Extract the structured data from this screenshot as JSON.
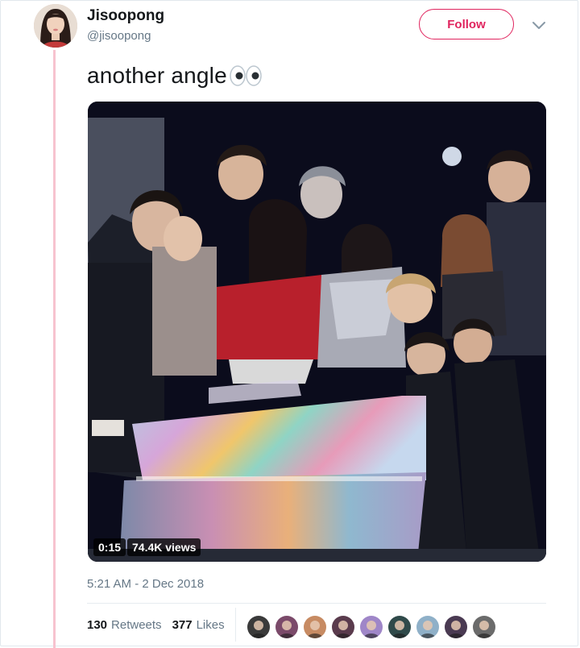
{
  "user": {
    "display_name": "Jisoopong",
    "handle": "@jisoopong",
    "avatar_icon": "profile-photo"
  },
  "follow_label": "Follow",
  "menu_icon": "chevron-down-icon",
  "tweet": {
    "text": "another angle",
    "emoji": "eyes-emoji"
  },
  "video": {
    "duration": "0:15",
    "views": "74.4K views"
  },
  "timestamp": "5:21 AM - 2 Dec 2018",
  "stats": {
    "retweets_count": "130",
    "retweets_label": "Retweets",
    "likes_count": "377",
    "likes_label": "Likes"
  },
  "likers": [
    {
      "color": "#3a3a3a"
    },
    {
      "color": "#7b4a6a"
    },
    {
      "color": "#c78b63"
    },
    {
      "color": "#5a3b4d"
    },
    {
      "color": "#9f86c8"
    },
    {
      "color": "#2f4a4a"
    },
    {
      "color": "#8fb0c8"
    },
    {
      "color": "#4a3a52"
    },
    {
      "color": "#6b6b6b"
    }
  ],
  "colors": {
    "accent": "#e0245e",
    "thread_line": "#f7c3cf",
    "muted_text": "#657786"
  }
}
